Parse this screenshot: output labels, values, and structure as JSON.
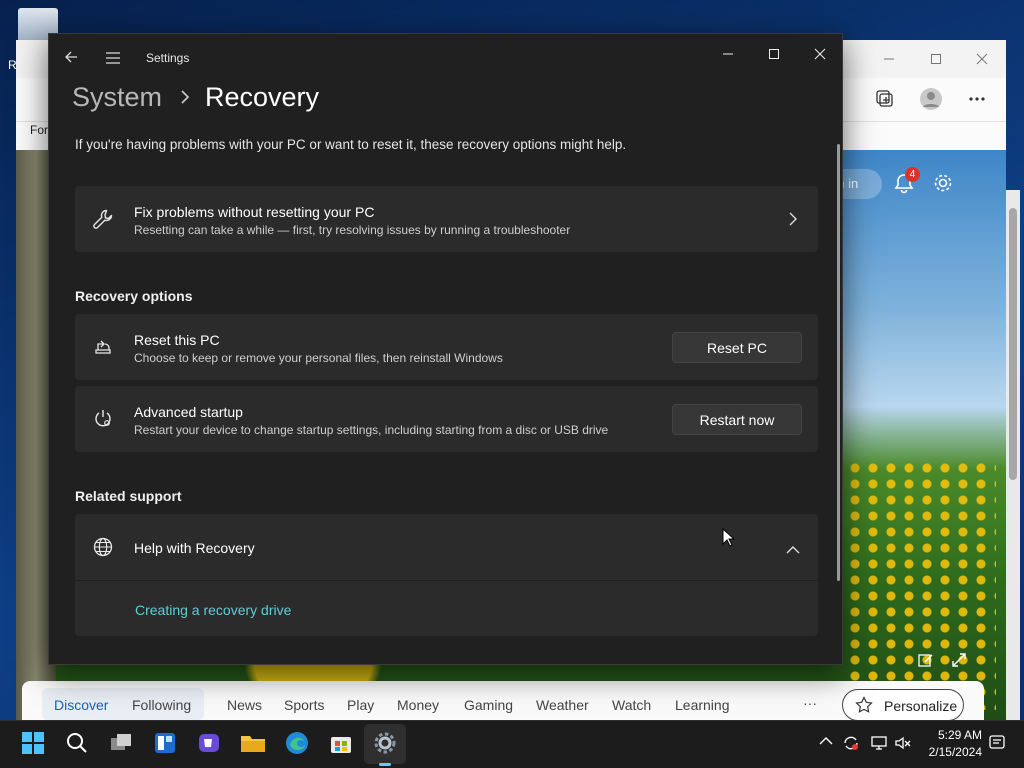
{
  "desktop": {
    "recycle_bin_label": "R"
  },
  "edge": {
    "favorites_label": "For",
    "signin_label": "gn in",
    "notification_count": "4",
    "feed_tabs": [
      "Discover",
      "Following",
      "News",
      "Sports",
      "Play",
      "Money",
      "Gaming",
      "Weather",
      "Watch",
      "Learning"
    ],
    "more_label": "···",
    "personalize_label": "Personalize"
  },
  "settings": {
    "window_title": "Settings",
    "breadcrumb_parent": "System",
    "breadcrumb_current": "Recovery",
    "intro": "If you're having problems with your PC or want to reset it, these recovery options might help.",
    "fix_card": {
      "title": "Fix problems without resetting your PC",
      "description": "Resetting can take a while — first, try resolving issues by running a troubleshooter"
    },
    "recovery_options_heading": "Recovery options",
    "reset_card": {
      "title": "Reset this PC",
      "description": "Choose to keep or remove your personal files, then reinstall Windows",
      "button": "Reset PC"
    },
    "advanced_card": {
      "title": "Advanced startup",
      "description": "Restart your device to change startup settings, including starting from a disc or USB drive",
      "button": "Restart now"
    },
    "related_support_heading": "Related support",
    "help_card": {
      "title": "Help with Recovery",
      "link": "Creating a recovery drive"
    }
  },
  "taskbar": {
    "time": "5:29 AM",
    "date": "2/15/2024"
  },
  "colors": {
    "accent": "#60cdff",
    "link": "#60cdd6",
    "settings_bg": "#202020",
    "card_bg": "#2b2b2b"
  }
}
